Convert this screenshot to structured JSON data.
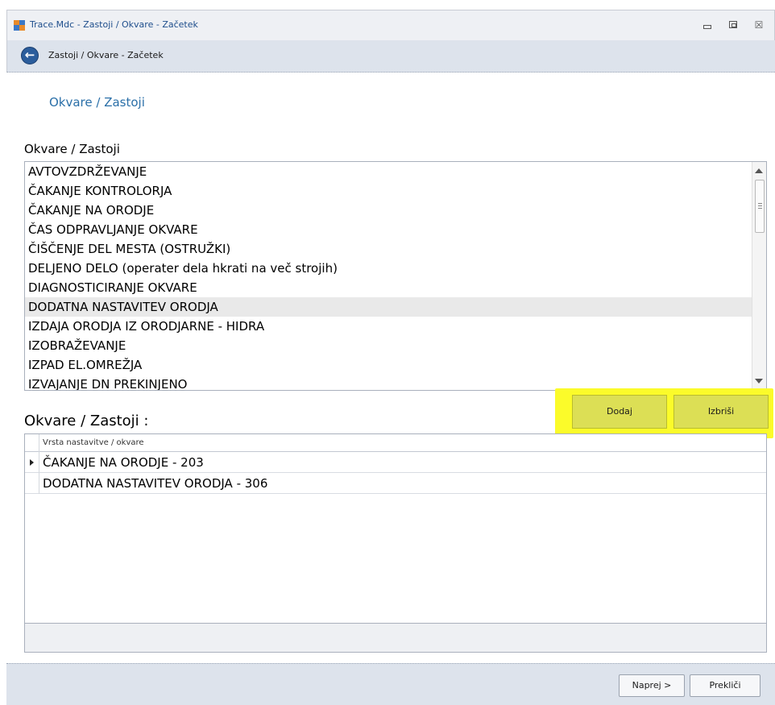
{
  "window": {
    "title": "Trace.Mdc - Zastoji / Okvare - Začetek",
    "min_icon": "minimize-icon",
    "max_icon": "maximize-icon",
    "close_icon": "close-icon",
    "close_glyph": "☒"
  },
  "nav": {
    "back_icon": "back-arrow-icon",
    "back_glyph": "←",
    "title": "Zastoji / Okvare - Začetek"
  },
  "section_link": "Okvare / Zastoji",
  "list": {
    "label": "Okvare / Zastoji",
    "items": [
      "AVTOVZDRŽEVANJE",
      "ČAKANJE KONTROLORJA",
      "ČAKANJE NA ORODJE",
      "ČAS ODPRAVLJANJE OKVARE",
      "ČIŠČENJE DEL MESTA (OSTRUŽKI)",
      "DELJENO DELO (operater dela hkrati na več strojih)",
      "DIAGNOSTICIRANJE OKVARE",
      "DODATNA NASTAVITEV ORODJA",
      "IZDAJA ORODJA IZ ORODJARNE - HIDRA",
      "IZOBRAŽEVANJE",
      "IZPAD EL.OMREŽJA",
      "IZVAJANJE DN PREKINJENO"
    ],
    "selected_index": 7
  },
  "actions": {
    "add_label": "Dodaj",
    "delete_label": "Izbriši",
    "highlight_color": "#fbfb2a"
  },
  "grid": {
    "label": "Okvare / Zastoji :",
    "column_header": "Vrsta nastavitve / okvare",
    "rows": [
      "ČAKANJE NA ORODJE - 203",
      "DODATNA NASTAVITEV ORODJA - 306"
    ],
    "current_row": 0
  },
  "footer": {
    "next_label": "Naprej >",
    "cancel_label": "Prekliči"
  },
  "colors": {
    "accent": "#2a6fa8",
    "nav_bg": "#dde3ec"
  }
}
